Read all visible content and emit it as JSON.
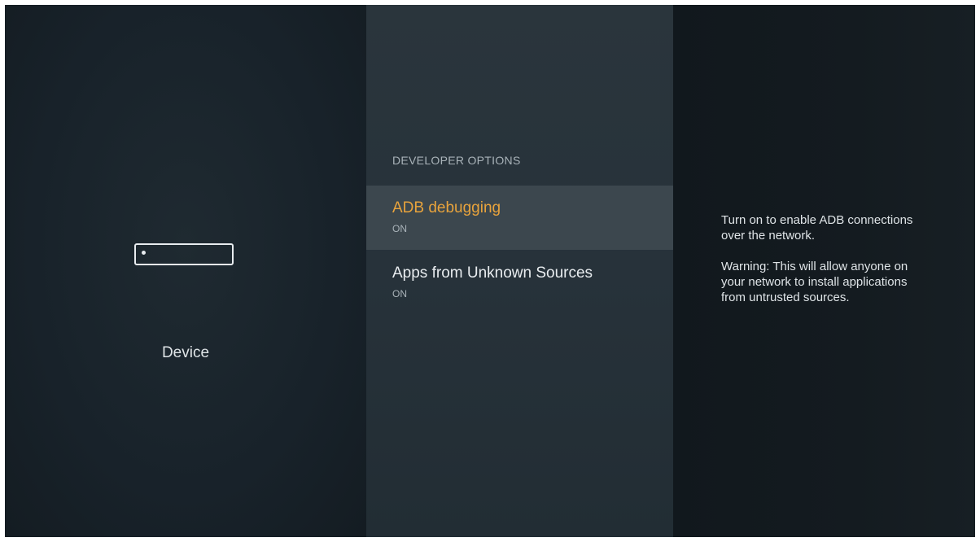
{
  "left": {
    "device_icon": "tv-device-icon",
    "label": "Device"
  },
  "middle": {
    "section_header": "DEVELOPER OPTIONS",
    "items": [
      {
        "title": "ADB debugging",
        "value": "ON",
        "selected": true
      },
      {
        "title": "Apps from Unknown Sources",
        "value": "ON",
        "selected": false
      }
    ]
  },
  "right": {
    "description": "Turn on to enable ADB connections over the network.",
    "warning": "Warning: This will allow anyone on your network to install applications from untrusted sources."
  },
  "colors": {
    "accent": "#e8a33c",
    "selected_bg": "#3c474e"
  }
}
